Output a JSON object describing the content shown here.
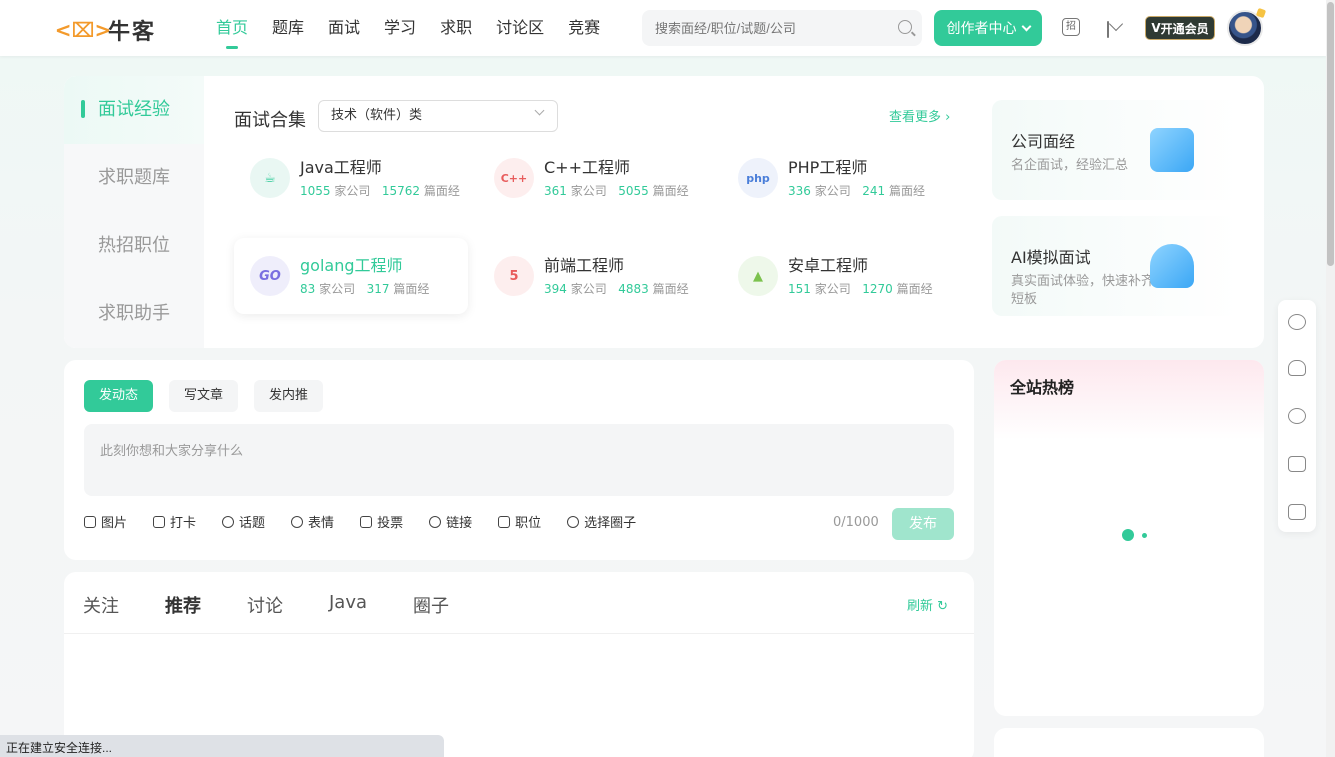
{
  "header": {
    "logo_text": "牛客",
    "nav": [
      "首页",
      "题库",
      "面试",
      "学习",
      "求职",
      "讨论区",
      "竞赛"
    ],
    "search_placeholder": "搜索面经/职位/试题/公司",
    "creator_label": "创作者中心",
    "recruit_icon_text": "招",
    "vip_label": "开通会员",
    "vip_prefix": "V"
  },
  "side_menu": [
    "面试经验",
    "求职题库",
    "热招职位",
    "求职助手"
  ],
  "interview": {
    "title": "面试合集",
    "select_value": "技术（软件）类",
    "more_label": "查看更多",
    "jobs": [
      {
        "name": "Java工程师",
        "companies": "1055",
        "companies_label": "家公司",
        "posts": "15762",
        "posts_label": "篇面经",
        "icon": "java-icon",
        "icon_text": "☕"
      },
      {
        "name": "C++工程师",
        "companies": "361",
        "companies_label": "家公司",
        "posts": "5055",
        "posts_label": "篇面经",
        "icon": "cpp-icon",
        "icon_text": "C++"
      },
      {
        "name": "PHP工程师",
        "companies": "336",
        "companies_label": "家公司",
        "posts": "241",
        "posts_label": "篇面经",
        "icon": "php-icon",
        "icon_text": "php"
      },
      {
        "name": "golang工程师",
        "companies": "83",
        "companies_label": "家公司",
        "posts": "317",
        "posts_label": "篇面经",
        "icon": "go-icon",
        "icon_text": "GO"
      },
      {
        "name": "前端工程师",
        "companies": "394",
        "companies_label": "家公司",
        "posts": "4883",
        "posts_label": "篇面经",
        "icon": "html5-icon",
        "icon_text": "5"
      },
      {
        "name": "安卓工程师",
        "companies": "151",
        "companies_label": "家公司",
        "posts": "1270",
        "posts_label": "篇面经",
        "icon": "android-icon",
        "icon_text": "▲"
      }
    ],
    "promos": [
      {
        "title": "公司面经",
        "desc": "名企面试，经验汇总"
      },
      {
        "title": "AI模拟面试",
        "desc": "真实面试体验，快速补齐短板"
      }
    ]
  },
  "post": {
    "tabs": [
      "发动态",
      "写文章",
      "发内推"
    ],
    "placeholder": "此刻你想和大家分享什么",
    "tools": [
      "图片",
      "打卡",
      "话题",
      "表情",
      "投票",
      "链接",
      "职位",
      "选择圈子"
    ],
    "count": "0/1000",
    "publish": "发布"
  },
  "feed": {
    "tabs": [
      "关注",
      "推荐",
      "讨论",
      "Java",
      "圈子"
    ],
    "refresh": "刷新"
  },
  "hot": {
    "title": "全站热榜"
  },
  "status_bar": "正在建立安全连接...",
  "colors": {
    "accent": "#32ca99",
    "vip_bg": "#2f3a33"
  }
}
